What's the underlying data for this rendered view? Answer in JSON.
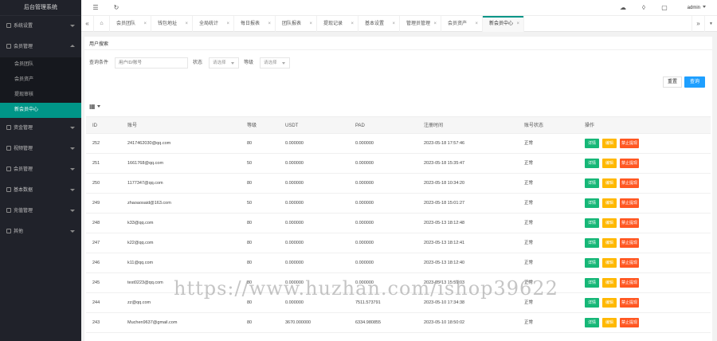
{
  "app": {
    "title": "后台管理系统"
  },
  "header": {
    "user": "admin"
  },
  "sidebar": {
    "items": [
      {
        "label": "系统设置",
        "open": false
      },
      {
        "label": "会员管理",
        "open": true,
        "children": [
          {
            "label": "会员团队",
            "active": false
          },
          {
            "label": "会员资产",
            "active": false
          },
          {
            "label": "提现审核",
            "active": false
          },
          {
            "label": "新会员中心",
            "active": true
          }
        ]
      },
      {
        "label": "资金管理",
        "open": false
      },
      {
        "label": "视频管理",
        "open": false
      },
      {
        "label": "会员管理",
        "open": false
      },
      {
        "label": "基本数据",
        "open": false
      },
      {
        "label": "充值管理",
        "open": false
      },
      {
        "label": "其他",
        "open": false
      }
    ]
  },
  "tabs": [
    {
      "label": "会员团队",
      "active": false
    },
    {
      "label": "钱包地址",
      "active": false
    },
    {
      "label": "全局统计",
      "active": false
    },
    {
      "label": "每日报表",
      "active": false
    },
    {
      "label": "团队报表",
      "active": false
    },
    {
      "label": "提现记录",
      "active": false
    },
    {
      "label": "基本设置",
      "active": false
    },
    {
      "label": "管理员管理",
      "active": false
    },
    {
      "label": "会员资产",
      "active": false
    },
    {
      "label": "新会员中心",
      "active": true
    }
  ],
  "search": {
    "title": "用户搜索",
    "query_label": "查询条件",
    "query_placeholder": "用户ID/账号",
    "status_label": "状态",
    "status_value": "请选择",
    "level_label": "等级",
    "level_value": "请选择",
    "reset_label": "重置",
    "search_label": "查询"
  },
  "table": {
    "columns": [
      "ID",
      "账号",
      "等级",
      "USDT",
      "PAD",
      "注册时间",
      "账号状态",
      "操作"
    ],
    "actions": {
      "view": "详情",
      "edit": "编辑",
      "ban": "禁止提现"
    },
    "rows": [
      {
        "id": "252",
        "account": "2417462030@qq.com",
        "level": "80",
        "usdt": "0.000000",
        "pad": "0.000000",
        "time": "2023-05-18 17:57:46",
        "status": "正常"
      },
      {
        "id": "251",
        "account": "1661768@qq.com",
        "level": "50",
        "usdt": "0.000000",
        "pad": "0.000000",
        "time": "2023-05-18 15:35:47",
        "status": "正常"
      },
      {
        "id": "250",
        "account": "1177347@qq.com",
        "level": "80",
        "usdt": "0.000000",
        "pad": "0.000000",
        "time": "2023-05-18 10:34:20",
        "status": "正常"
      },
      {
        "id": "249",
        "account": "zhaoaosaid@163.com",
        "level": "50",
        "usdt": "0.000000",
        "pad": "0.000000",
        "time": "2023-05-18 15:01:27",
        "status": "正常"
      },
      {
        "id": "248",
        "account": "k33@qq.com",
        "level": "80",
        "usdt": "0.000000",
        "pad": "0.000000",
        "time": "2023-05-13 18:12:48",
        "status": "正常"
      },
      {
        "id": "247",
        "account": "k22@qq.com",
        "level": "80",
        "usdt": "0.000000",
        "pad": "0.000000",
        "time": "2023-05-13 18:12:41",
        "status": "正常"
      },
      {
        "id": "246",
        "account": "k11@qq.com",
        "level": "80",
        "usdt": "0.000000",
        "pad": "0.000000",
        "time": "2023-05-13 18:12:40",
        "status": "正常"
      },
      {
        "id": "245",
        "account": "test0223@qq.com",
        "level": "80",
        "usdt": "0.000000",
        "pad": "0.000000",
        "time": "2023-05-13 15:59:03",
        "status": "正常"
      },
      {
        "id": "244",
        "account": "zz@qq.com",
        "level": "80",
        "usdt": "0.000000",
        "pad": "7511.573791",
        "time": "2023-05-10 17:34:38",
        "status": "正常"
      },
      {
        "id": "243",
        "account": "Muchen9637@gmail.com",
        "level": "80",
        "usdt": "3670.000000",
        "pad": "6334.980855",
        "time": "2023-05-10 18:50:02",
        "status": "正常"
      }
    ]
  },
  "watermark": "https://www.huzhan.com/ishop39622"
}
